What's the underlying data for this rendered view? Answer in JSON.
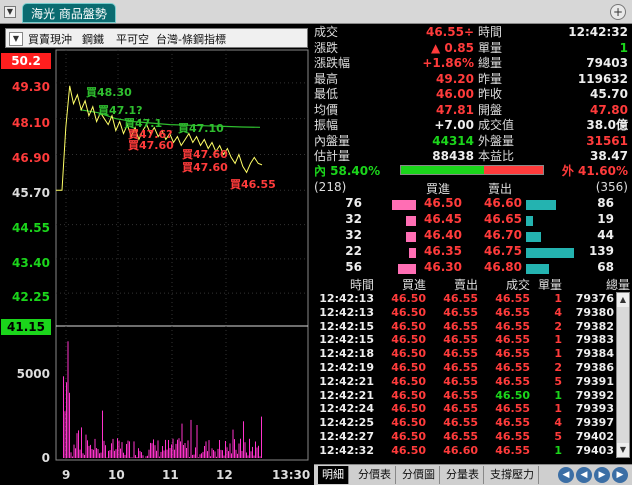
{
  "title": "海光 商品盤勢",
  "toolbar": {
    "items": [
      "買賣現沖",
      "鋼鐵",
      "平可空",
      "台灣-條鋼指標"
    ]
  },
  "yaxis": {
    "top": "50.2",
    "labels": [
      "49.30",
      "48.10",
      "46.90",
      "45.70",
      "44.55",
      "43.40",
      "42.25"
    ],
    "bottom": "41.15",
    "vol_labels": [
      "5000",
      "0"
    ]
  },
  "xaxis": [
    "9",
    "10",
    "11",
    "12",
    "13:30"
  ],
  "chart_annotations": {
    "green": [
      "買48.30",
      "買47.1?",
      "買47.1",
      "買47.10"
    ],
    "red": [
      "買47.6?",
      "買47.60",
      "買47.60",
      "買47.60",
      "買46.55"
    ]
  },
  "info": [
    {
      "k1": "成交",
      "v1": "46.55÷",
      "c1": "red",
      "k2": "時間",
      "v2": "12:42:32",
      "c2": "white"
    },
    {
      "k1": "漲跌",
      "v1": "▲ 0.85",
      "c1": "red",
      "k2": "單量",
      "v2": "1",
      "c2": "green"
    },
    {
      "k1": "漲跌幅",
      "v1": "+1.86%",
      "c1": "red",
      "k2": "總量",
      "v2": "79403",
      "c2": "white"
    },
    {
      "k1": "最高",
      "v1": "49.20",
      "c1": "red",
      "k2": "昨量",
      "v2": "119632",
      "c2": "white"
    },
    {
      "k1": "最低",
      "v1": "46.00",
      "c1": "red",
      "k2": "昨收",
      "v2": "45.70",
      "c2": "white"
    },
    {
      "k1": "均價",
      "v1": "47.81",
      "c1": "red",
      "k2": "開盤",
      "v2": "47.80",
      "c2": "red"
    },
    {
      "k1": "振幅",
      "v1": "+7.00",
      "c1": "white",
      "k2": "成交值",
      "v2": "38.0億",
      "c2": "white"
    },
    {
      "k1": "內盤量",
      "v1": "44314",
      "c1": "green",
      "k2": "外盤量",
      "v2": "31561",
      "c2": "red"
    },
    {
      "k1": "估計量",
      "v1": "88438",
      "c1": "white",
      "k2": "本益比",
      "v2": "38.47",
      "c2": "white"
    }
  ],
  "ratio": {
    "left": "內 58.40%",
    "right": "外 41.60%",
    "outer_fraction": 0.416
  },
  "orderbook": {
    "bid_total": "(218)",
    "ask_total": "(356)",
    "bid_header": "買進",
    "ask_header": "賣出",
    "rows": [
      {
        "bv": "76",
        "bp": "46.50",
        "ap": "46.60",
        "av": "86"
      },
      {
        "bv": "32",
        "bp": "46.45",
        "ap": "46.65",
        "av": "19"
      },
      {
        "bv": "32",
        "bp": "46.40",
        "ap": "46.70",
        "av": "44"
      },
      {
        "bv": "22",
        "bp": "46.35",
        "ap": "46.75",
        "av": "139"
      },
      {
        "bv": "56",
        "bp": "46.30",
        "ap": "46.80",
        "av": "68"
      }
    ]
  },
  "ticks": {
    "headers": [
      "時間",
      "買進",
      "賣出",
      "成交",
      "單量",
      "總量"
    ],
    "rows": [
      [
        "12:42:13",
        "46.50",
        "46.55",
        "46.55",
        "1",
        "79376"
      ],
      [
        "12:42:13",
        "46.50",
        "46.55",
        "46.55",
        "4",
        "79380"
      ],
      [
        "12:42:15",
        "46.50",
        "46.55",
        "46.55",
        "2",
        "79382"
      ],
      [
        "12:42:15",
        "46.50",
        "46.55",
        "46.55",
        "1",
        "79383"
      ],
      [
        "12:42:18",
        "46.50",
        "46.55",
        "46.55",
        "1",
        "79384"
      ],
      [
        "12:42:19",
        "46.50",
        "46.55",
        "46.55",
        "2",
        "79386"
      ],
      [
        "12:42:21",
        "46.50",
        "46.55",
        "46.55",
        "5",
        "79391"
      ],
      [
        "12:42:21",
        "46.50",
        "46.55",
        "46.50",
        "1",
        "79392"
      ],
      [
        "12:42:24",
        "46.50",
        "46.55",
        "46.55",
        "1",
        "79393"
      ],
      [
        "12:42:25",
        "46.50",
        "46.55",
        "46.55",
        "4",
        "79397"
      ],
      [
        "12:42:27",
        "46.50",
        "46.55",
        "46.55",
        "5",
        "79402"
      ],
      [
        "12:42:32",
        "46.50",
        "46.60",
        "46.55",
        "1",
        "79403"
      ]
    ]
  },
  "tabs": [
    "明細",
    "分價表",
    "分價圖",
    "分量表",
    "支撐壓力"
  ]
}
